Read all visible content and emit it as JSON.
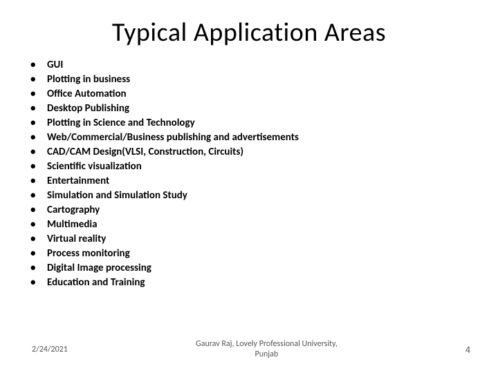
{
  "slide": {
    "title": "Typical Application Areas",
    "bullets": [
      "GUI",
      "Plotting in business",
      "Office Automation",
      "Desktop Publishing",
      "Plotting in Science and Technology",
      "Web/Commercial/Business publishing and advertisements",
      "CAD/CAM Design(VLSI, Construction, Circuits)",
      "Scientific visualization",
      "Entertainment",
      "Simulation and Simulation Study",
      "Cartography",
      "Multimedia",
      "Virtual reality",
      "Process monitoring",
      "Digital Image processing",
      "Education and Training"
    ]
  },
  "footer": {
    "date": "2/24/2021",
    "author_line1": "Gaurav Raj, Lovely Professional University,",
    "author_line2": "Punjab",
    "page": "4"
  }
}
